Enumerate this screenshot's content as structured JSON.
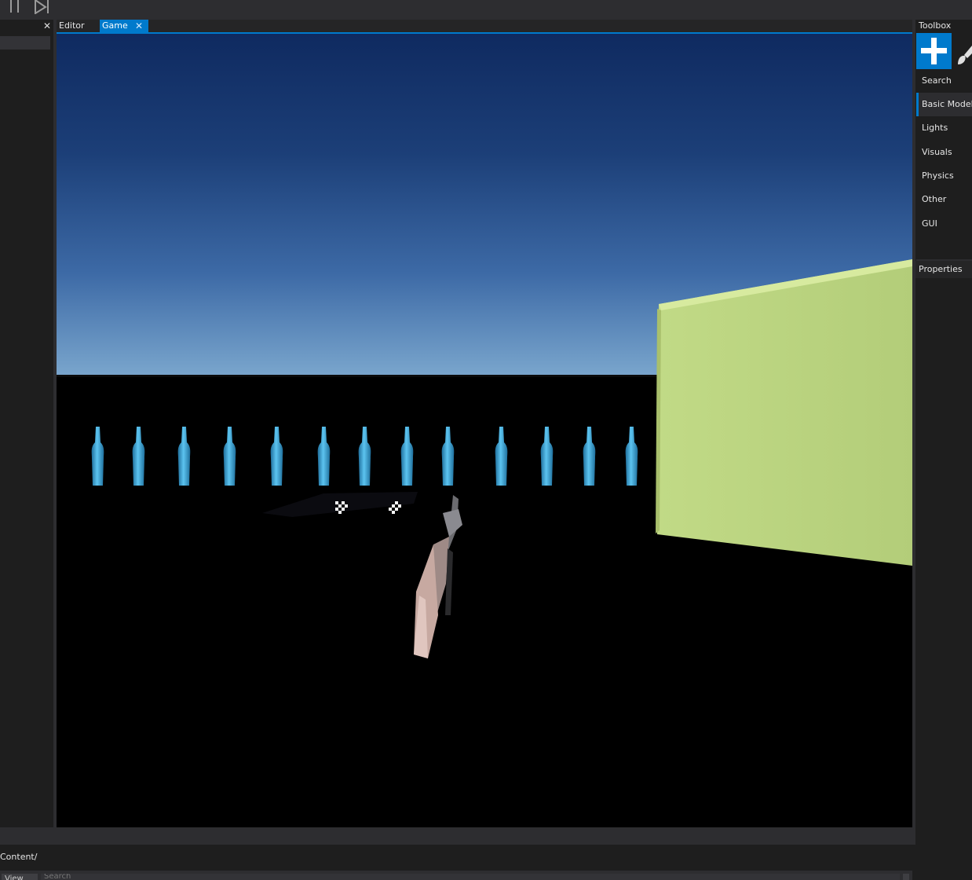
{
  "toolbar": {
    "pause_icon": "pause-icon",
    "step_icon": "step-frame-icon"
  },
  "left_panel": {
    "close_glyph": "✕"
  },
  "tabs": [
    {
      "label": "Editor"
    },
    {
      "label": "Game",
      "active": true,
      "close_glyph": "✕"
    }
  ],
  "toolbox": {
    "title": "Toolbox",
    "tool_icons": [
      "add-icon",
      "paint-brush-icon"
    ],
    "categories": [
      {
        "label": "Search"
      },
      {
        "label": "Basic Models",
        "active": true
      },
      {
        "label": "Lights"
      },
      {
        "label": "Visuals"
      },
      {
        "label": "Physics"
      },
      {
        "label": "Other"
      },
      {
        "label": "GUI"
      }
    ]
  },
  "properties": {
    "title": "Properties"
  },
  "content_browser": {
    "path": "Content/",
    "view_label": "View",
    "search_placeholder": "Search"
  },
  "scene": {
    "sky_colors": [
      "#0f2a60",
      "#7aa6cd"
    ],
    "bottle_color": "#3fa8dc",
    "bottle_count": 14,
    "box_color": "#b9d27f"
  },
  "colors": {
    "accent": "#007acc",
    "panel": "#1e1e1e",
    "toolbar": "#2d2d30"
  }
}
